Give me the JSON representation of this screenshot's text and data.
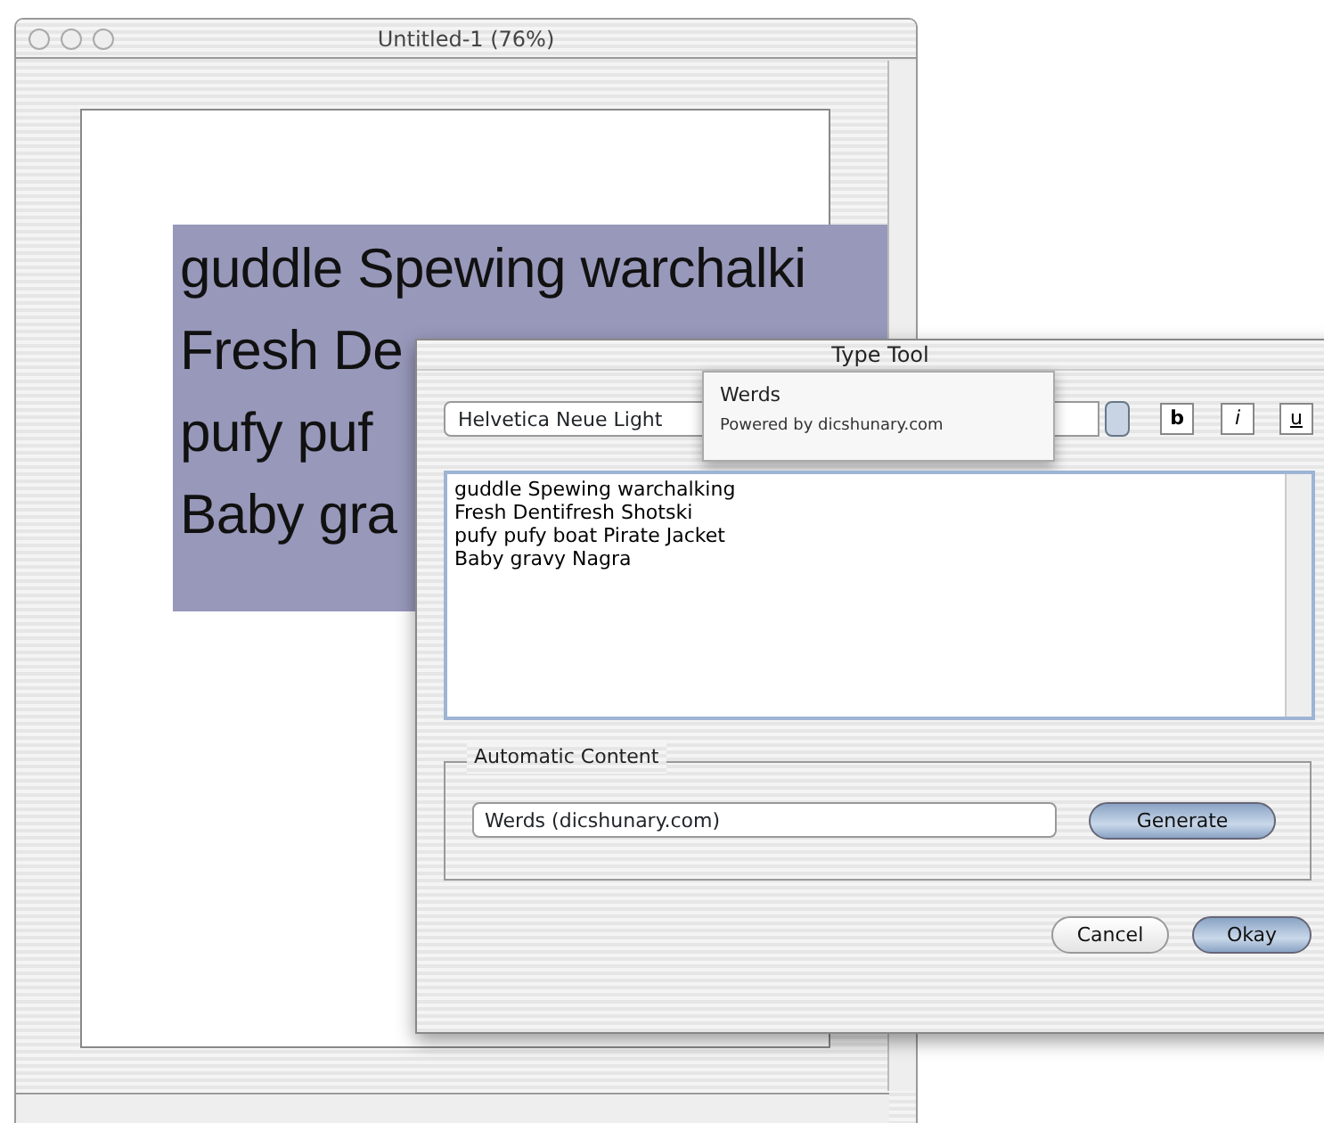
{
  "document_window": {
    "title": "Untitled-1 (76%)",
    "text_lines": [
      "guddle Spewing warchalki",
      "Fresh De",
      "pufy puf",
      "Baby gra"
    ]
  },
  "type_tool": {
    "title": "Type Tool",
    "font": "Helvetica Neue Light",
    "style_buttons": [
      {
        "label": "b",
        "kind": "bold"
      },
      {
        "label": "i",
        "kind": "italic"
      },
      {
        "label": "u",
        "kind": "underline"
      }
    ],
    "text": "guddle Spewing warchalking\nFresh Dentifresh Shotski\npufy pufy boat Pirate Jacket\nBaby gravy Nagra",
    "popup": [
      {
        "label": "Werds",
        "kind": "item"
      },
      {
        "label": "Powered by dicshunary.com",
        "kind": "note"
      }
    ],
    "automatic_content": {
      "legend": "Automatic Content",
      "source": "Werds (dicshunary.com)",
      "generate": "Generate"
    },
    "buttons": [
      {
        "label": "Cancel",
        "default": false
      },
      {
        "label": "Okay",
        "default": true
      }
    ]
  }
}
